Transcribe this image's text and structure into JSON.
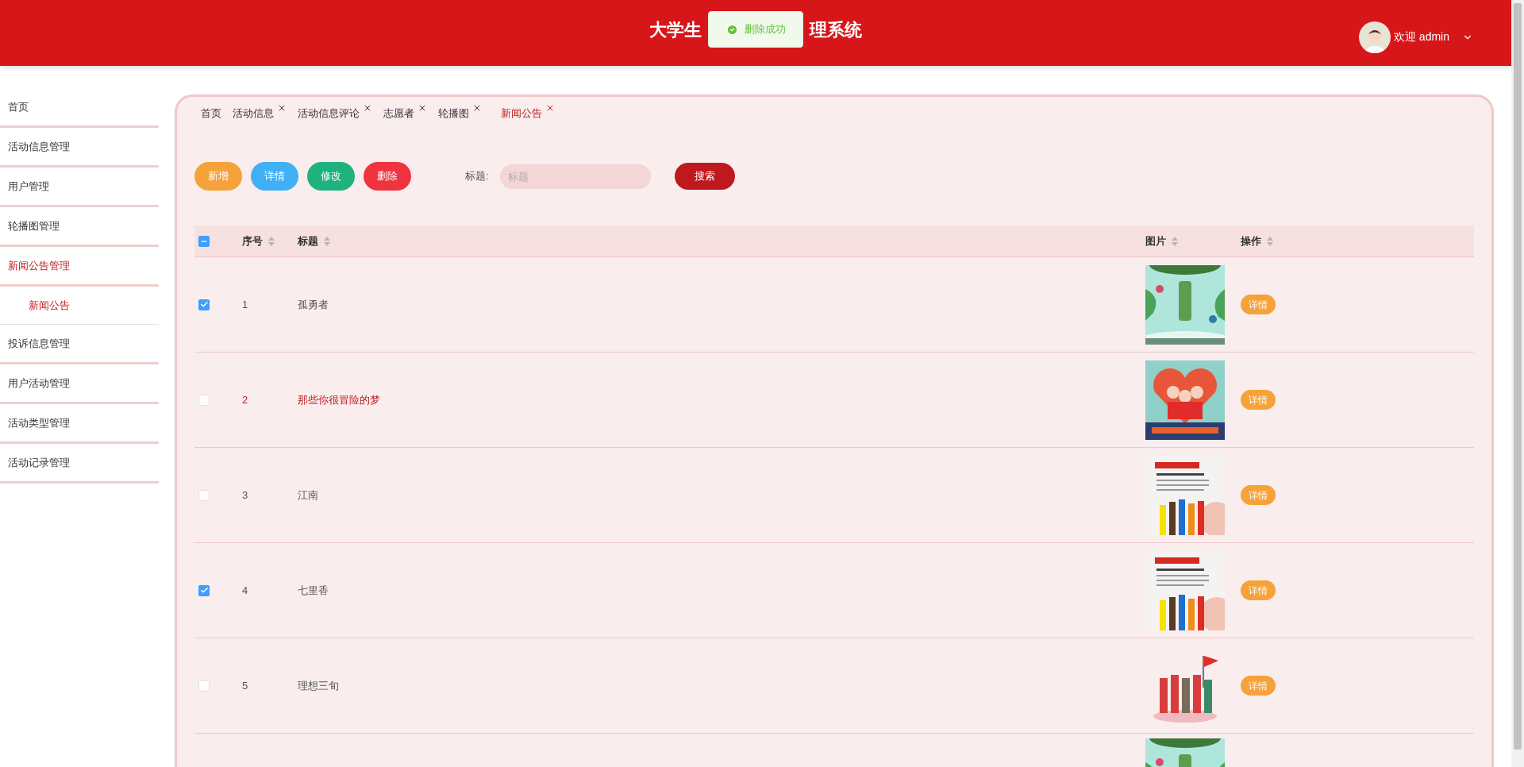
{
  "header": {
    "title_left": "大学生",
    "title_right": "理系统",
    "toast": {
      "text": "删除成功"
    },
    "user": {
      "greeting": "欢迎 admin"
    }
  },
  "sidebar": {
    "items": [
      {
        "label": "首页",
        "selected": false
      },
      {
        "label": "活动信息管理",
        "selected": false
      },
      {
        "label": "用户管理",
        "selected": false
      },
      {
        "label": "轮播图管理",
        "selected": false
      },
      {
        "label": "新闻公告管理",
        "selected": true,
        "children": [
          {
            "label": "新闻公告",
            "selected": true
          }
        ]
      },
      {
        "label": "投诉信息管理",
        "selected": false
      },
      {
        "label": "用户活动管理",
        "selected": false
      },
      {
        "label": "活动类型管理",
        "selected": false
      },
      {
        "label": "活动记录管理",
        "selected": false
      }
    ]
  },
  "tabs": [
    {
      "label": "首页",
      "selected": false,
      "closable": false
    },
    {
      "label": "活动信息",
      "selected": false,
      "closable": true
    },
    {
      "label": "活动信息评论",
      "selected": false,
      "closable": true
    },
    {
      "label": "志愿者",
      "selected": false,
      "closable": true
    },
    {
      "label": "轮播图",
      "selected": false,
      "closable": true
    },
    {
      "label": "新闻公告",
      "selected": true,
      "closable": true
    }
  ],
  "toolbar": {
    "buttons": [
      {
        "label": "新增",
        "color": "#f5a23a"
      },
      {
        "label": "详情",
        "color": "#3fb0f5"
      },
      {
        "label": "修改",
        "color": "#1fb27f"
      },
      {
        "label": "删除",
        "color": "#f0333f"
      }
    ],
    "search_label": "标题:",
    "search": {
      "placeholder": "标题"
    },
    "search_button": "搜索"
  },
  "table": {
    "select_all": {
      "indeterminate": true
    },
    "columns": [
      "序号",
      "标题",
      "图片",
      "操作"
    ],
    "rows": [
      {
        "checked": true,
        "hovered": false,
        "number": "1",
        "title": "孤勇者",
        "action": "详情"
      },
      {
        "checked": false,
        "hovered": true,
        "number": "2",
        "title": "那些你很冒险的梦",
        "action": "详情"
      },
      {
        "checked": false,
        "hovered": false,
        "number": "3",
        "title": "江南",
        "action": "详情"
      },
      {
        "checked": true,
        "hovered": false,
        "number": "4",
        "title": "七里香",
        "action": "详情"
      },
      {
        "checked": false,
        "hovered": false,
        "number": "5",
        "title": "理想三旬",
        "action": "详情"
      },
      {
        "kind": "picture"
      }
    ]
  }
}
